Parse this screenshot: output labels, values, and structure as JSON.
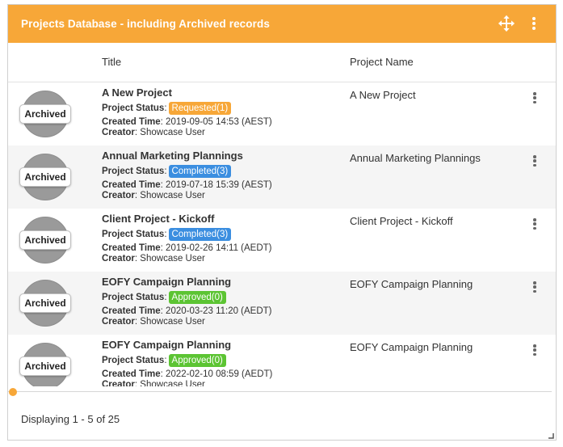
{
  "panel": {
    "title": "Projects Database - including Archived records",
    "accent_color": "#f7a738",
    "header_icons": [
      "move-icon",
      "more-vertical-icon"
    ]
  },
  "columns": {
    "title": "Title",
    "project_name": "Project Name"
  },
  "labels": {
    "status": "Project Status",
    "created": "Created Time",
    "creator": "Creator"
  },
  "rows": [
    {
      "badge": "Archived",
      "title": "A New Project",
      "status": "Requested(1)",
      "status_kind": "requested",
      "created": "2019-09-05 14:53 (AEST)",
      "creator": "Showcase User",
      "project_name": "A New Project"
    },
    {
      "badge": "Archived",
      "title": "Annual Marketing Plannings",
      "status": "Completed(3)",
      "status_kind": "completed",
      "created": "2019-07-18 15:39 (AEST)",
      "creator": "Showcase User",
      "project_name": "Annual Marketing Plannings"
    },
    {
      "badge": "Archived",
      "title": "Client Project - Kickoff",
      "status": "Completed(3)",
      "status_kind": "completed",
      "created": "2019-02-26 14:11 (AEDT)",
      "creator": "Showcase User",
      "project_name": "Client Project - Kickoff"
    },
    {
      "badge": "Archived",
      "title": "EOFY Campaign Planning",
      "status": "Approved(0)",
      "status_kind": "approved",
      "created": "2020-03-23 11:20 (AEDT)",
      "creator": "Showcase User",
      "project_name": "EOFY Campaign Planning"
    },
    {
      "badge": "Archived",
      "title": "EOFY Campaign Planning",
      "status": "Approved(0)",
      "status_kind": "approved",
      "created": "2022-02-10 08:59 (AEDT)",
      "creator": "Showcase User",
      "project_name": "EOFY Campaign Planning"
    }
  ],
  "status_colors": {
    "requested": "#f7a738",
    "completed": "#3b8ee0",
    "approved": "#5cc433"
  },
  "footer": {
    "paging": "Displaying 1 - 5 of 25"
  }
}
